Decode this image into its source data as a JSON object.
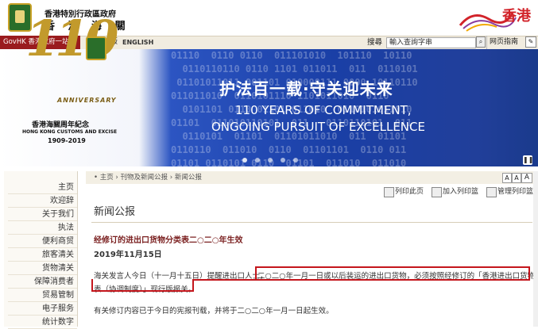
{
  "header": {
    "org_line1": "香港特別行政區政府",
    "org_line2": "香 港 海 關",
    "brand": "香港"
  },
  "topnav": {
    "govhk": "GovHK 香港政府一站通",
    "lang_tc": "繁體版",
    "lang_en": "ENGLISH",
    "search_label": "搜尋",
    "search_placeholder": "輸入查詢字串",
    "site_guide": "网页指南"
  },
  "banner": {
    "anniversary_number": "110",
    "anniversary_word": "ANNIVERSARY",
    "anniversary_zh": "香港海關周年紀念",
    "anniversary_en": "HONG KONG CUSTOMS AND EXCISE",
    "anniversary_years": "1909-2019",
    "slogan_zh": "护法百一载·守关迎未来",
    "slogan_en_line1": "110 YEARS OF COMMITMENT,",
    "slogan_en_line2": "ONGOING PURSUIT OF EXCELLENCE",
    "binary": "01110  0110 0110  011101010  101110  10110\n  0110110110 0110 1101 011011  011  0110101\n 01101011011 001101 010000111 0000 10110110\n011011010  0110101110 1101011010  0110\n  0101101 0110 01101 011010  0110101011010\n01101  011010110101  011   0110110101  011\n  0110101  01101  01101011010  011  01101\n0110110  011010  0110  01101101  0110 011\n01101 0110101 0110  01101  011010  011010"
  },
  "sidebar": {
    "items": [
      "主页",
      "欢迎辞",
      "关于我们",
      "执法",
      "便利商贸",
      "旅客清关",
      "货物清关",
      "保障消费者",
      "贸易管制",
      "电子服务",
      "统计数字"
    ]
  },
  "content": {
    "breadcrumb": "• 主页 › 刊物及新闻公报 › 新闻公报",
    "font_small": "A",
    "font_medium": "A",
    "font_large": "A",
    "tool_print": "列印此页",
    "tool_add": "加入列印篮",
    "tool_manage": "管理列印篮",
    "page_title": "新闻公报",
    "article_title": "经修订的进出口货物分类表二○二○年生效",
    "article_date": "2019年11月15日",
    "para1_part1": "海关发言人今日（十一月十五日）提醒进出口人士，",
    "para1_part2": "二○二○年一月一日或以后装运的进出口货物，必须按照经修订的「香港进出口货物分类",
    "para1_part3": "表（协调制度）」现行版报关。",
    "para2": "有关修订内容已于今日的宪报刊载，并将于二○二○年一月一日起生效。"
  },
  "colors": {
    "govhk_red": "#9a1b1e",
    "highlight_red": "#c4161c",
    "banner_blue": "#1a3fa6",
    "gold": "#c29a2c"
  },
  "icons": [
    "emblem-icon",
    "search-icon",
    "tool-icon",
    "pause-icon",
    "print-icon",
    "add-basket-icon",
    "manage-basket-icon"
  ]
}
